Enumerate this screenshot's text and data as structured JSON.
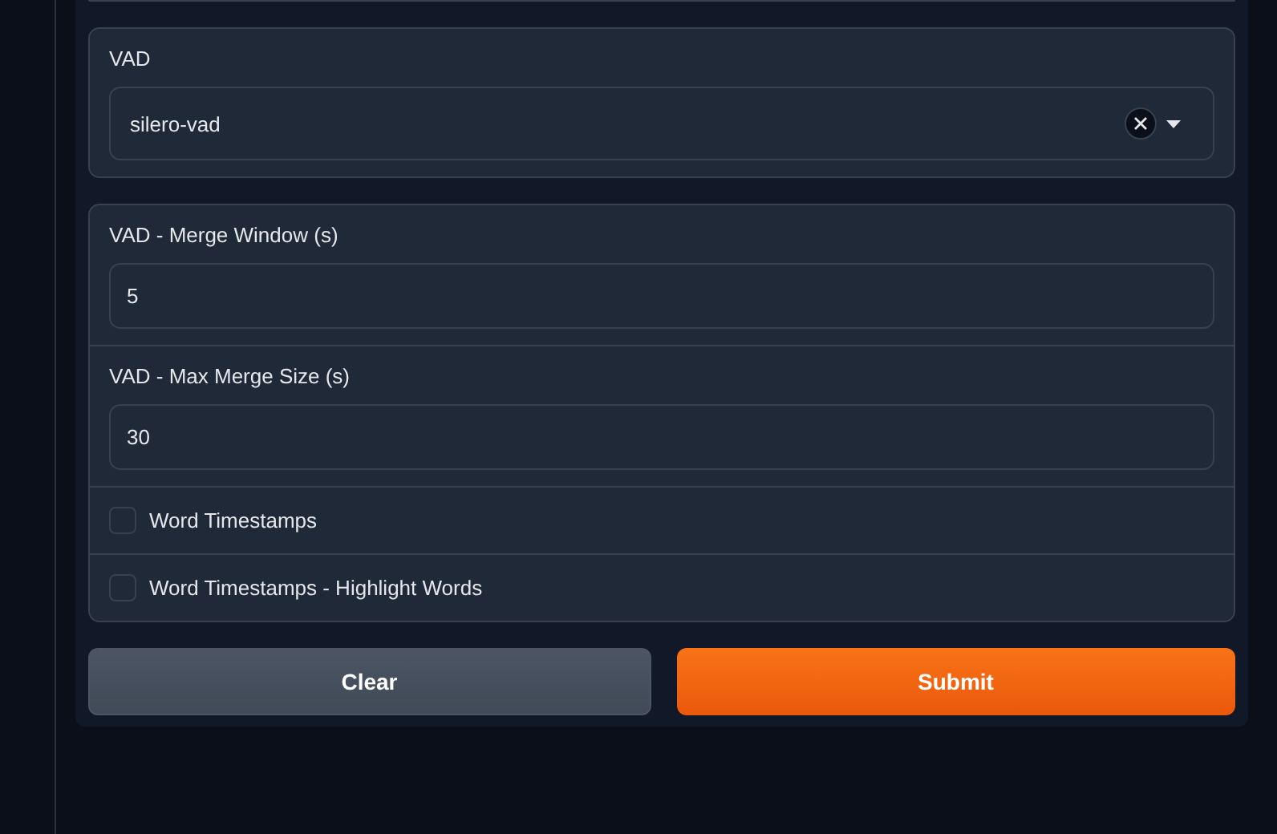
{
  "vad": {
    "label": "VAD",
    "value": "silero-vad"
  },
  "numbers": [
    {
      "label": "VAD - Merge Window (s)",
      "value": "5"
    },
    {
      "label": "VAD - Max Merge Size (s)",
      "value": "30"
    }
  ],
  "checkboxes": [
    {
      "label": "Word Timestamps",
      "checked": false
    },
    {
      "label": "Word Timestamps - Highlight Words",
      "checked": false
    }
  ],
  "buttons": [
    {
      "label": "Clear",
      "kind": "secondary"
    },
    {
      "label": "Submit",
      "kind": "primary"
    }
  ]
}
